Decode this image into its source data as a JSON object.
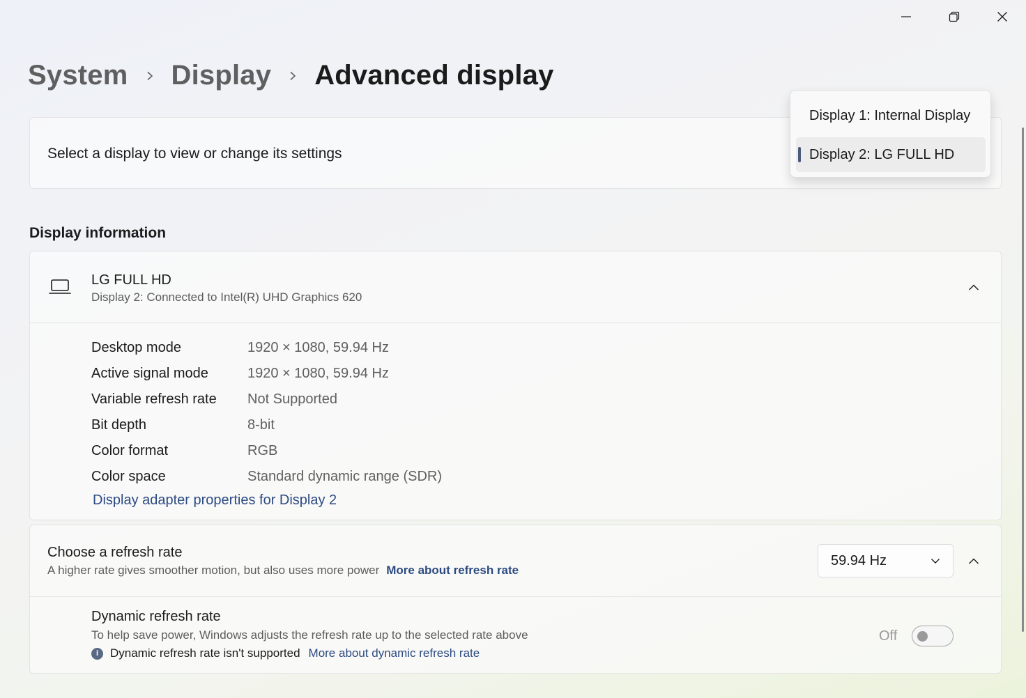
{
  "window": {
    "controls": [
      {
        "name": "minimize-icon"
      },
      {
        "name": "restore-icon"
      },
      {
        "name": "close-icon"
      }
    ]
  },
  "breadcrumb": {
    "items": [
      "System",
      "Display",
      "Advanced display"
    ]
  },
  "select_display": {
    "label": "Select a display to view or change its settings"
  },
  "dropdown": {
    "options": [
      "Display 1: Internal Display",
      "Display 2: LG FULL HD"
    ],
    "selected_index": 1
  },
  "display_information": {
    "section_title": "Display information",
    "name": "LG FULL HD",
    "subtitle": "Display 2: Connected to Intel(R) UHD Graphics 620",
    "rows": [
      {
        "label": "Desktop mode",
        "value": "1920 × 1080, 59.94 Hz"
      },
      {
        "label": "Active signal mode",
        "value": "1920 × 1080, 59.94 Hz"
      },
      {
        "label": "Variable refresh rate",
        "value": "Not Supported"
      },
      {
        "label": "Bit depth",
        "value": "8-bit"
      },
      {
        "label": "Color format",
        "value": "RGB"
      },
      {
        "label": "Color space",
        "value": "Standard dynamic range (SDR)"
      }
    ],
    "adapter_link": "Display adapter properties for Display 2"
  },
  "refresh_rate": {
    "title": "Choose a refresh rate",
    "subtitle": "A higher rate gives smoother motion, but also uses more power",
    "link": "More about refresh rate",
    "selected_rate": "59.94 Hz",
    "dynamic": {
      "title": "Dynamic refresh rate",
      "subtitle": "To help save power, Windows adjusts the refresh rate up to the selected rate above",
      "note": "Dynamic refresh rate isn't supported",
      "note_link": "More about dynamic refresh rate",
      "toggle_label": "Off",
      "toggle_on": false
    }
  },
  "colors": {
    "link": "#2c4a82",
    "selection_indicator": "#4a5a78"
  }
}
